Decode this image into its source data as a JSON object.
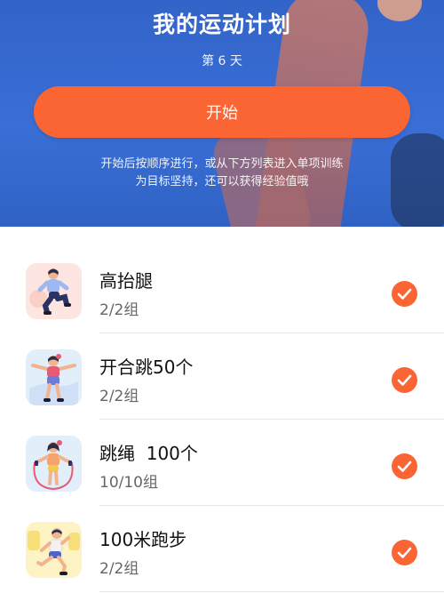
{
  "header": {
    "title": "我的运动计划",
    "day_label": "第 6 天",
    "start_label": "开始",
    "hint_line1": "开始后按顺序进行，或从下方列表进入单项训练",
    "hint_line2": "为目标坚持，还可以获得经验值哦"
  },
  "exercises": [
    {
      "name": "高抬腿",
      "sets": "2/2组",
      "icon": "high-knees-illustration",
      "completed": true
    },
    {
      "name": "开合跳50个",
      "sets": "2/2组",
      "icon": "jumping-jacks-illustration",
      "completed": true
    },
    {
      "name": "跳绳  100个",
      "sets": "10/10组",
      "icon": "jump-rope-illustration",
      "completed": true
    },
    {
      "name": "100米跑步",
      "sets": "2/2组",
      "icon": "sprint-illustration",
      "completed": true
    }
  ],
  "colors": {
    "accent": "#fb6433",
    "header_blue": "#3a6fd6"
  }
}
